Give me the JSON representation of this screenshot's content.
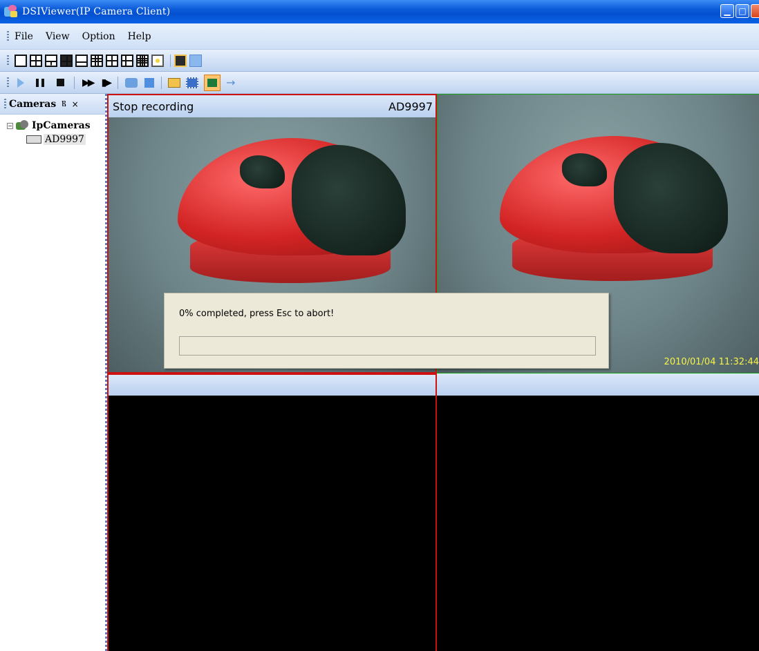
{
  "window": {
    "title": "DSIViewer(IP Camera Client)"
  },
  "menu": {
    "items": [
      "File",
      "View",
      "Option",
      "Help"
    ]
  },
  "left_panel": {
    "title": "Cameras",
    "pin_glyph": "Ⲃ",
    "close_glyph": "×",
    "tree": {
      "root_label": "IpCameras",
      "expander": "−",
      "children": [
        "AD9997"
      ]
    }
  },
  "cells": {
    "top_left": {
      "status": "Stop recording",
      "camera": "AD9997"
    },
    "top_right": {
      "timestamp": "2010/01/04 11:32:44"
    }
  },
  "dialog": {
    "message": "0% completed, press Esc to abort!",
    "progress": 0
  },
  "colors": {
    "active_cell_border": "#cc1111",
    "focus_cell_border": "#1aa21a",
    "timestamp": "#f6f34a"
  }
}
